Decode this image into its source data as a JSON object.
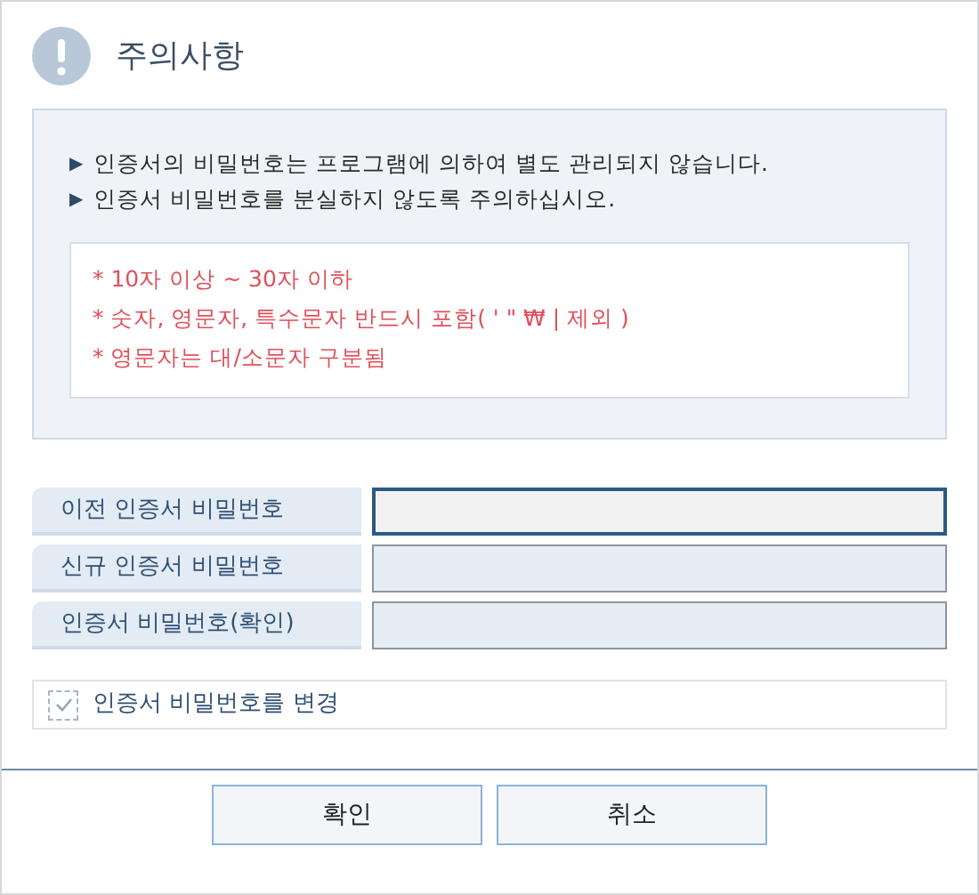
{
  "title": "주의사항",
  "notices": [
    "인증서의 비밀번호는 프로그램에 의하여 별도 관리되지 않습니다.",
    "인증서 비밀번호를 분실하지 않도록 주의하십시오."
  ],
  "bullet": "▶",
  "rules": [
    "* 10자 이상 ~ 30자 이하",
    "* 숫자, 영문자, 특수문자 반드시 포함( ' \" ₩ | 제외 )",
    "* 영문자는 대/소문자 구분됨"
  ],
  "fields": [
    {
      "label": "이전 인증서 비밀번호",
      "focused": true
    },
    {
      "label": "신규 인증서 비밀번호",
      "focused": false
    },
    {
      "label": "인증서 비밀번호(확인)",
      "focused": false
    }
  ],
  "checkbox": {
    "label": "인증서 비밀번호를 변경",
    "checked": true
  },
  "buttons": [
    "확인",
    "취소"
  ]
}
